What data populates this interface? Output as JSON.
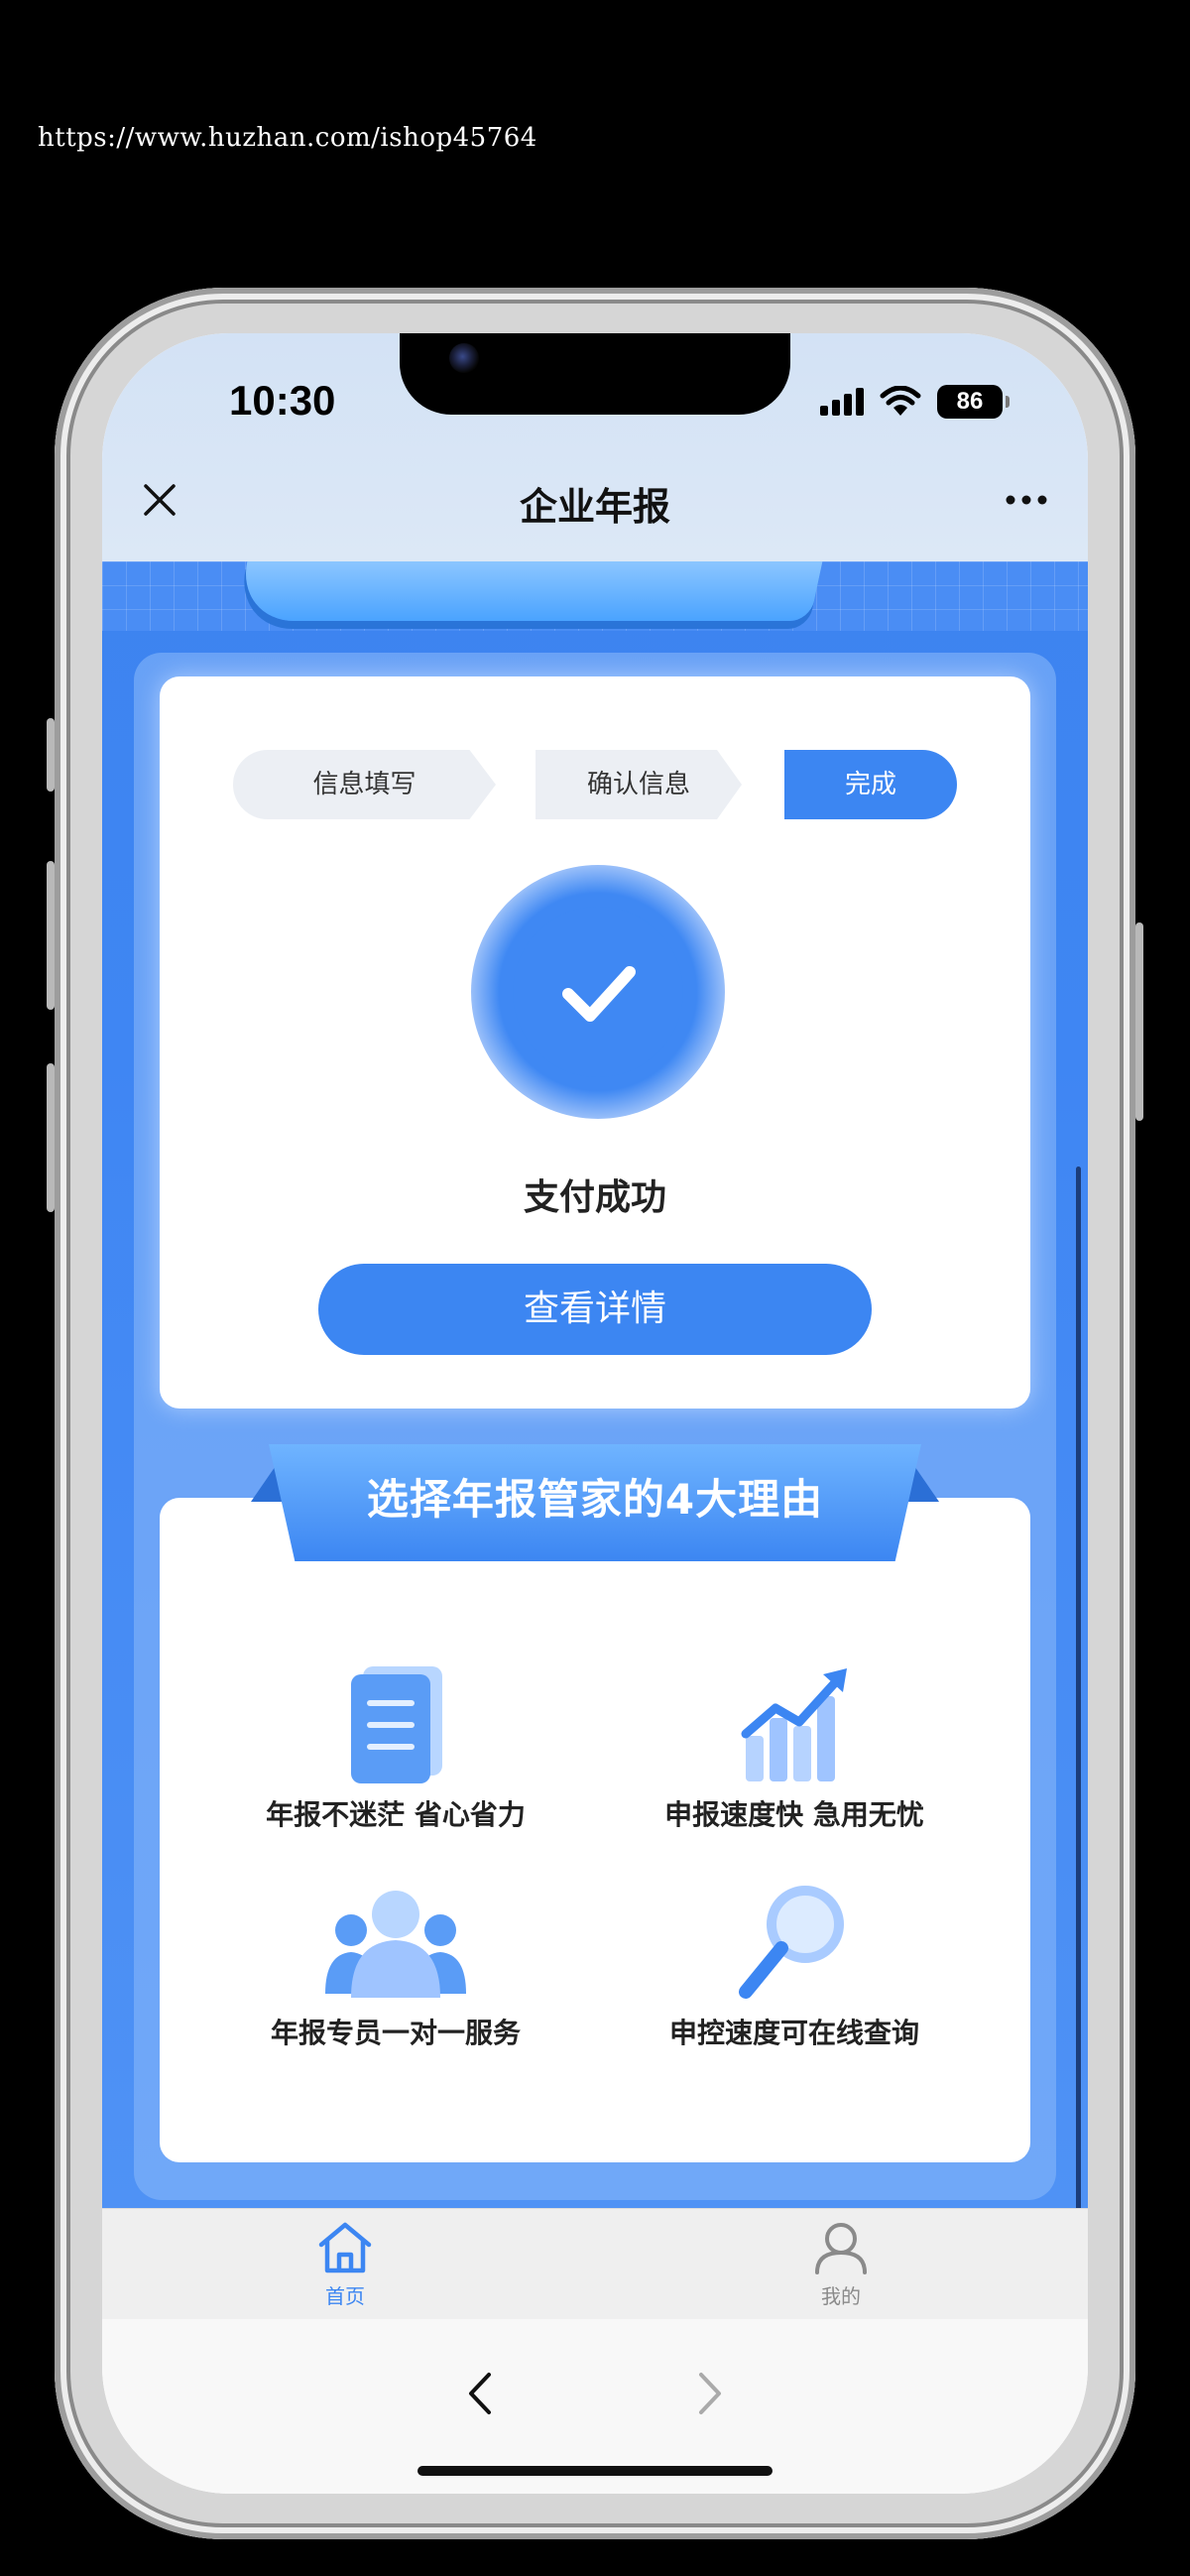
{
  "watermark_url": "https://www.huzhan.com/ishop45764",
  "status_bar": {
    "time": "10:30",
    "battery": "86"
  },
  "nav": {
    "title": "企业年报"
  },
  "steps": [
    "信息填写",
    "确认信息",
    "完成"
  ],
  "steps_active_index": 2,
  "result": {
    "title": "支付成功",
    "button": "查看详情"
  },
  "reasons": {
    "title": "选择年报管家的4大理由",
    "items": [
      {
        "label": "年报不迷茫 省心省力",
        "icon": "document-icon"
      },
      {
        "label": "申报速度快 急用无忧",
        "icon": "growth-chart-icon"
      },
      {
        "label": "年报专员一对一服务",
        "icon": "people-icon"
      },
      {
        "label": "申控速度可在线查询",
        "icon": "magnifier-icon"
      }
    ]
  },
  "tabbar": {
    "items": [
      {
        "label": "首页",
        "icon": "home-icon",
        "active": true
      },
      {
        "label": "我的",
        "icon": "user-icon",
        "active": false
      }
    ],
    "active_color": "#3c86f2",
    "inactive_color": "#8a8a8a"
  },
  "colors": {
    "primary": "#3c86f2",
    "background_blue": "#3f86f3"
  }
}
